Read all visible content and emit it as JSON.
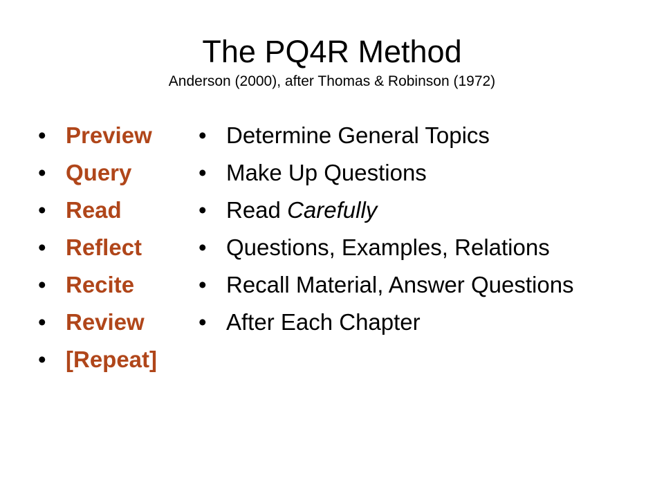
{
  "title": "The PQ4R Method",
  "subtitle": "Anderson (2000), after Thomas & Robinson (1972)",
  "accent_color": "#b0461a",
  "bullet_glyph": "•",
  "steps": [
    {
      "label": "Preview"
    },
    {
      "label": "Query"
    },
    {
      "label": "Read"
    },
    {
      "label": "Reflect"
    },
    {
      "label": "Recite"
    },
    {
      "label": "Review"
    },
    {
      "label": "[Repeat]"
    }
  ],
  "descriptions": [
    {
      "text": "Determine General Topics"
    },
    {
      "text": "Make Up Questions"
    },
    {
      "text": "Read ",
      "emphasis": "Carefully"
    },
    {
      "text": "Questions, Examples, Relations"
    },
    {
      "text": "Recall Material, Answer Questions"
    },
    {
      "text": "After Each Chapter"
    }
  ]
}
